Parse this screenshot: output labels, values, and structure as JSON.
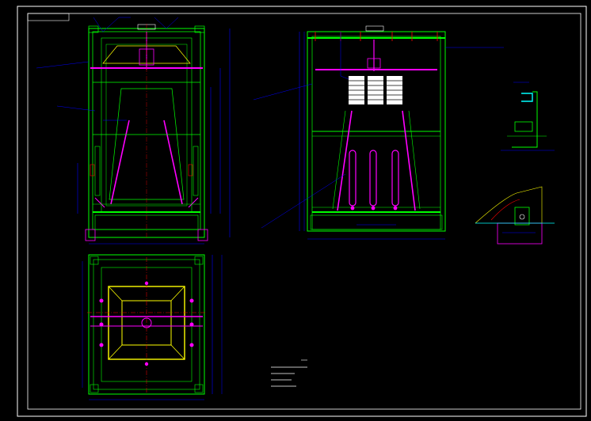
{
  "drawing": {
    "background": "#000000",
    "colors": {
      "frame": "#ffffff",
      "structure": "#00ff00",
      "outline": "#ffff00",
      "accent": "#ff00ff",
      "dimension": "#0000ff",
      "centerline": "#ff0000",
      "detail": "#00ffff",
      "text": "#ffffff"
    },
    "views": [
      "front-elevation",
      "side-elevation",
      "plan-view",
      "section-detail-top",
      "section-detail-bottom"
    ],
    "notes": {
      "line_1": "",
      "line_2": "",
      "line_3": "",
      "line_4": ""
    }
  }
}
